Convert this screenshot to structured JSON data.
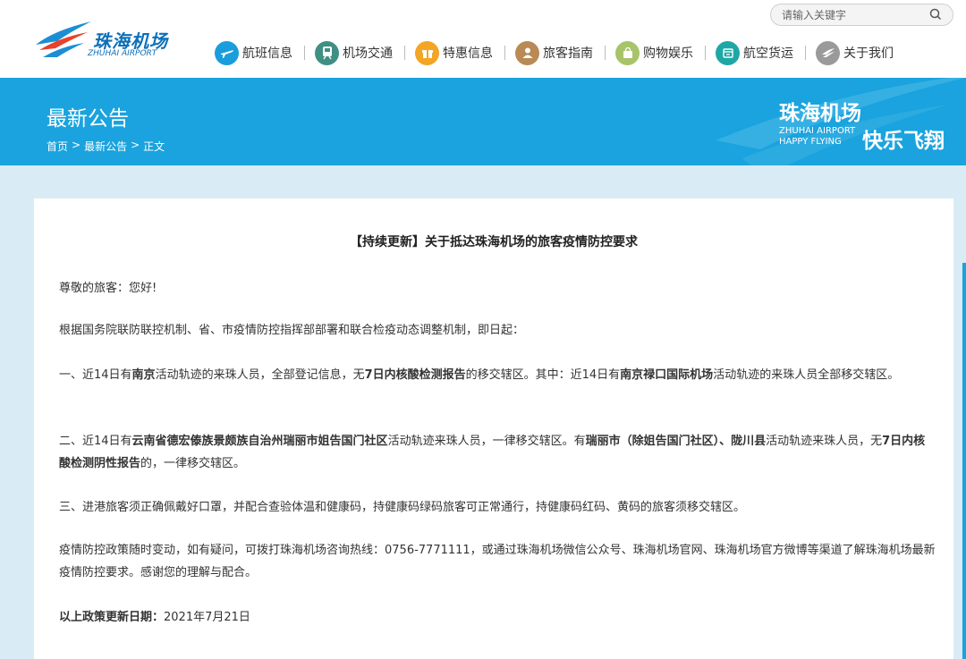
{
  "header": {
    "logo_cn": "珠海机场",
    "logo_en": "ZHUHAI AIRPORT",
    "search_placeholder": "请输入关键字",
    "nav": [
      {
        "label": "航班信息",
        "icon": "plane-icon",
        "color": "#1a9ddc"
      },
      {
        "label": "机场交通",
        "icon": "train-icon",
        "color": "#3f8f84"
      },
      {
        "label": "特惠信息",
        "icon": "gift-icon",
        "color": "#f2a623"
      },
      {
        "label": "旅客指南",
        "icon": "person-icon",
        "color": "#b98a55"
      },
      {
        "label": "购物娱乐",
        "icon": "shopping-bag-icon",
        "color": "#a8c46a"
      },
      {
        "label": "航空货运",
        "icon": "cargo-icon",
        "color": "#1ea7a5"
      },
      {
        "label": "关于我们",
        "icon": "about-logo-icon",
        "color": "#9a9a9a"
      }
    ]
  },
  "banner": {
    "title": "最新公告",
    "breadcrumb": [
      "首页",
      ">",
      "最新公告",
      ">",
      "正文"
    ],
    "slogan_cn": "珠海机场",
    "slogan_en_line1": "ZHUHAI AIRPORT",
    "slogan_en_line2": "HAPPY FLYING",
    "slogan_happy": "快乐飞翔"
  },
  "article": {
    "title": "【持续更新】关于抵达珠海机场的旅客疫情防控要求",
    "greeting": "尊敬的旅客：您好!",
    "intro": "根据国务院联防联控机制、省、市疫情防控指挥部部署和联合检疫动态调整机制，即日起：",
    "p1": [
      {
        "t": "一、近14日有",
        "b": false
      },
      {
        "t": "南京",
        "b": true
      },
      {
        "t": "活动轨迹的来珠人员，全部登记信息，无",
        "b": false
      },
      {
        "t": "7日内核酸检测报告",
        "b": true
      },
      {
        "t": "的移交辖区。其中：近14日有",
        "b": false
      },
      {
        "t": "南京禄口国际机场",
        "b": true
      },
      {
        "t": "活动轨迹的来珠人员全部移交辖区。",
        "b": false
      }
    ],
    "p2": [
      {
        "t": "二、近14日有",
        "b": false
      },
      {
        "t": "云南省德宏傣族景颇族自治州瑞丽市姐告国门社区",
        "b": true
      },
      {
        "t": "活动轨迹来珠人员，一律移交辖区。有",
        "b": false
      },
      {
        "t": "瑞丽市（除姐告国门社区）、陇川县",
        "b": true
      },
      {
        "t": "活动轨迹来珠人员，无",
        "b": false
      },
      {
        "t": "7日内核酸检测阴性报告",
        "b": true
      },
      {
        "t": "的，一律移交辖区。",
        "b": false
      }
    ],
    "p3": "三、进港旅客须正确佩戴好口罩，并配合查验体温和健康码，持健康码绿码旅客可正常通行，持健康码红码、黄码的旅客须移交辖区。",
    "p4": "疫情防控政策随时变动，如有疑问，可拨打珠海机场咨询热线：0756-7771111，或通过珠海机场微信公众号、珠海机场官网、珠海机场官方微博等渠道了解珠海机场最新疫情防控要求。感谢您的理解与配合。",
    "update_label": "以上政策更新日期：",
    "update_date": "2021年7月21日"
  }
}
